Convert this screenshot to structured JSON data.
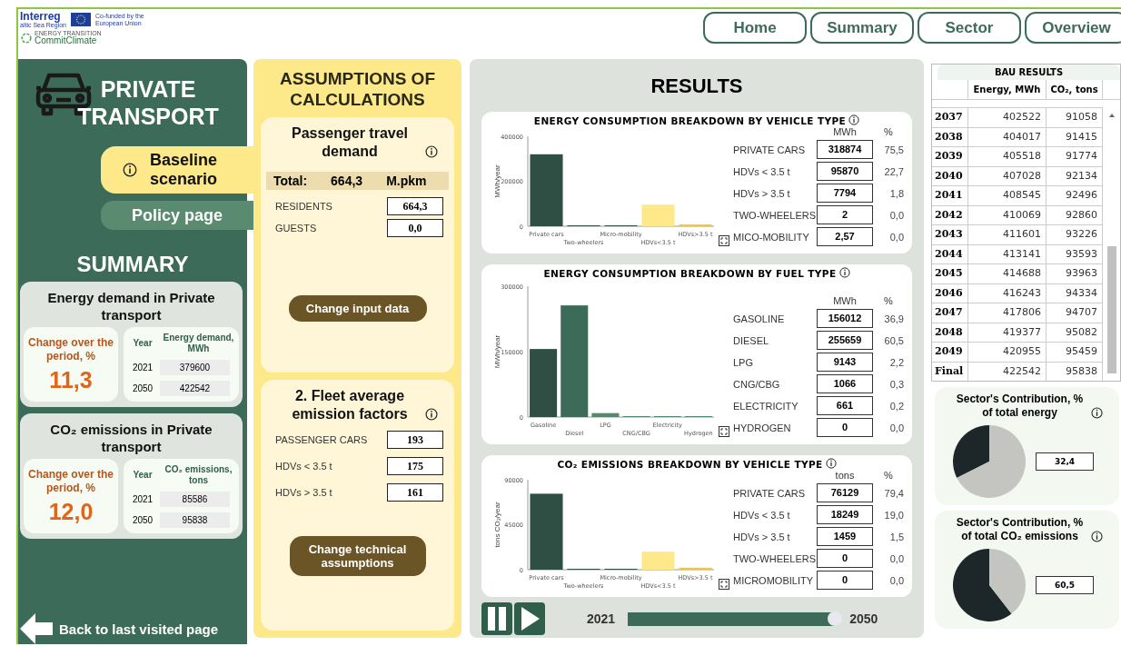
{
  "header": {
    "logos": {
      "interreg": "Interreg",
      "region": "altic Sea Region",
      "eu": "Co-funded by the European Union",
      "transition": "ENERGY TRANSITION",
      "project": "CommitClimate"
    },
    "nav": [
      {
        "label": "Home"
      },
      {
        "label": "Summary"
      },
      {
        "label": "Sector"
      },
      {
        "label": "Overview"
      }
    ]
  },
  "sidebar": {
    "title": "PRIVATE TRANSPORT",
    "scenarios": [
      {
        "label": "Baseline scenario",
        "selected": true
      },
      {
        "label": "Policy page",
        "selected": false
      }
    ],
    "summary_title": "SUMMARY",
    "cards": [
      {
        "title": "Energy demand in Private transport",
        "change_label": "Change over the period, %",
        "change_value": "11,3",
        "year_header": "Year",
        "value_header": "Energy demand, MWh",
        "rows": [
          {
            "year": "2021",
            "value": "379600"
          },
          {
            "year": "2050",
            "value": "422542"
          }
        ]
      },
      {
        "title": "CO₂ emissions in Private transport",
        "change_label": "Change over the period, %",
        "change_value": "12,0",
        "year_header": "Year",
        "value_header": "CO₂ emissions, tons",
        "rows": [
          {
            "year": "2021",
            "value": "85586"
          },
          {
            "year": "2050",
            "value": "95838"
          }
        ]
      }
    ],
    "back_link": "Back to last visited page"
  },
  "assumptions": {
    "title": "ASSUMPTIONS OF CALCULATIONS",
    "sections": [
      {
        "title": "Passenger travel demand",
        "total": {
          "label": "Total:",
          "value": "664,3",
          "unit": "M.pkm"
        },
        "rows": [
          {
            "label": "RESIDENTS",
            "value": "664,3"
          },
          {
            "label": "GUESTS",
            "value": "0,0"
          }
        ],
        "button": "Change input data"
      },
      {
        "title": "2. Fleet average emission factors",
        "rows": [
          {
            "label": "PASSENGER CARS",
            "value": "193"
          },
          {
            "label": "HDVs < 3.5 t",
            "value": "175"
          },
          {
            "label": "HDVs > 3.5 t",
            "value": "161"
          }
        ],
        "button": "Change technical assumptions"
      }
    ]
  },
  "results": {
    "title": "RESULTS",
    "charts": [
      {
        "title": "ENERGY CONSUMPTION BREAKDOWN BY VEHICLE TYPE",
        "unit_header": "MWh",
        "pct_header": "%",
        "rows": [
          {
            "label": "PRIVATE CARS",
            "value": "318874",
            "pct": "75,5"
          },
          {
            "label": "HDVs < 3.5 t",
            "value": "95870",
            "pct": "22,7"
          },
          {
            "label": "HDVs > 3.5 t",
            "value": "7794",
            "pct": "1,8"
          },
          {
            "label": "TWO-WHEELERS",
            "value": "2",
            "pct": "0,0"
          },
          {
            "label": "MICO-MOBILITY",
            "value": "2,57",
            "pct": "0,0"
          }
        ],
        "chart_data": {
          "type": "bar",
          "ylabel": "MWh/year",
          "categories": [
            "Private cars",
            "Two-wheelers",
            "Micro-mobility",
            "HDVs<3.5 t",
            "HDVs>3.5 t"
          ],
          "ylim": [
            0,
            400000
          ],
          "yticks": [
            0,
            200000,
            400000
          ],
          "values": [
            320000,
            0,
            0,
            96000,
            8000
          ],
          "colors": [
            "#2f4f45",
            "#2f4f45",
            "#2f4f45",
            "#fde98a",
            "#f3c641"
          ]
        }
      },
      {
        "title": "ENERGY CONSUMPTION BREAKDOWN BY FUEL TYPE",
        "unit_header": "MWh",
        "pct_header": "%",
        "rows": [
          {
            "label": "GASOLINE",
            "value": "156012",
            "pct": "36,9"
          },
          {
            "label": "DIESEL",
            "value": "255659",
            "pct": "60,5"
          },
          {
            "label": "LPG",
            "value": "9143",
            "pct": "2,2"
          },
          {
            "label": "CNG/CBG",
            "value": "1066",
            "pct": "0,3"
          },
          {
            "label": "ELECTRICITY",
            "value": "661",
            "pct": "0,2"
          },
          {
            "label": "HYDROGEN",
            "value": "0",
            "pct": "0,0"
          }
        ],
        "chart_data": {
          "type": "bar",
          "ylabel": "MWh/year",
          "categories": [
            "Gasoline",
            "Diesel",
            "LPG",
            "CNG/CBG",
            "Electricity",
            "Hydrogen"
          ],
          "ylim": [
            0,
            300000
          ],
          "yticks": [
            0,
            150000,
            300000
          ],
          "values": [
            156000,
            256000,
            9000,
            1000,
            1000,
            0
          ],
          "colors": [
            "#2f4f45",
            "#3d6b59",
            "#558a6e",
            "#558a6e",
            "#558a6e",
            "#558a6e"
          ]
        }
      },
      {
        "title": "CO₂ EMISSIONS BREAKDOWN BY VEHICLE TYPE",
        "unit_header": "tons",
        "pct_header": "%",
        "rows": [
          {
            "label": "PRIVATE CARS",
            "value": "76129",
            "pct": "79,4"
          },
          {
            "label": "HDVs < 3.5 t",
            "value": "18249",
            "pct": "19,0"
          },
          {
            "label": "HDVs > 3.5 t",
            "value": "1459",
            "pct": "1,5"
          },
          {
            "label": "TWO-WHEELERS",
            "value": "0",
            "pct": "0,0"
          },
          {
            "label": "MICROMOBILITY",
            "value": "0",
            "pct": "0,0"
          }
        ],
        "chart_data": {
          "type": "bar",
          "ylabel": "tons CO₂/year",
          "categories": [
            "Private cars",
            "Two-wheelers",
            "Micro-mobility",
            "HDVs<3.5 t",
            "HDVs>3.5 t"
          ],
          "ylim": [
            0,
            90000
          ],
          "yticks": [
            0,
            45000,
            90000
          ],
          "values": [
            76000,
            0,
            0,
            18000,
            2000
          ],
          "colors": [
            "#2f4f45",
            "#2f4f45",
            "#2f4f45",
            "#fde98a",
            "#f3c641"
          ]
        }
      }
    ],
    "player": {
      "start": "2021",
      "end": "2050",
      "level": 0.98
    }
  },
  "bau": {
    "title": "BAU RESULTS",
    "columns": [
      "Energy, MWh",
      "CO₂, tons"
    ],
    "rows": [
      {
        "year": "2037",
        "energy": "402522",
        "co2": "91058"
      },
      {
        "year": "2038",
        "energy": "404017",
        "co2": "91415"
      },
      {
        "year": "2039",
        "energy": "405518",
        "co2": "91774"
      },
      {
        "year": "2040",
        "energy": "407028",
        "co2": "92134"
      },
      {
        "year": "2041",
        "energy": "408545",
        "co2": "92496"
      },
      {
        "year": "2042",
        "energy": "410069",
        "co2": "92860"
      },
      {
        "year": "2043",
        "energy": "411601",
        "co2": "93226"
      },
      {
        "year": "2044",
        "energy": "413141",
        "co2": "93593"
      },
      {
        "year": "2045",
        "energy": "414688",
        "co2": "93963"
      },
      {
        "year": "2046",
        "energy": "416243",
        "co2": "94334"
      },
      {
        "year": "2047",
        "energy": "417806",
        "co2": "94707"
      },
      {
        "year": "2048",
        "energy": "419377",
        "co2": "95082"
      },
      {
        "year": "2049",
        "energy": "420955",
        "co2": "95459"
      },
      {
        "year": "Final",
        "energy": "422542",
        "co2": "95838"
      }
    ]
  },
  "contributions": [
    {
      "title": "Sector's Contribution, % of total energy",
      "value": "32,4",
      "chart_data": {
        "type": "pie",
        "values": [
          32.4,
          67.6
        ]
      }
    },
    {
      "title": "Sector's Contribution, % of total CO₂ emissions",
      "value": "60,5",
      "chart_data": {
        "type": "pie",
        "values": [
          60.5,
          39.5
        ]
      }
    }
  ]
}
